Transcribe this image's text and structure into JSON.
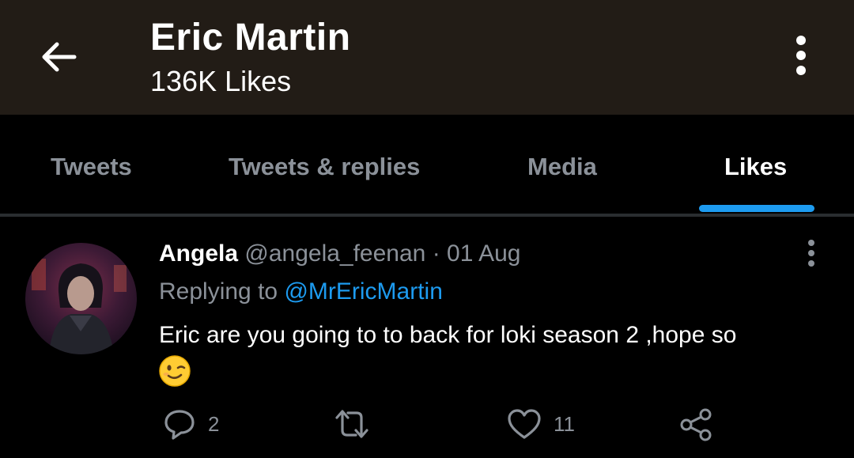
{
  "header": {
    "title": "Eric Martin",
    "subtitle": "136K Likes"
  },
  "tabs": [
    {
      "label": "Tweets",
      "active": false
    },
    {
      "label": "Tweets & replies",
      "active": false
    },
    {
      "label": "Media",
      "active": false
    },
    {
      "label": "Likes",
      "active": true
    }
  ],
  "tweet": {
    "name": "Angela",
    "handle": "@angela_feenan",
    "separator": "·",
    "date": "01 Aug",
    "replying_prefix": "Replying to",
    "replying_to": "@MrEricMartin",
    "text": "Eric are you going to to back for loki season 2 ,hope so",
    "emoji": "winking-face",
    "reply_count": "2",
    "retweet_count": "",
    "like_count": "11"
  },
  "colors": {
    "header_bg": "#221c16",
    "accent": "#1d9bf0",
    "muted_text": "#8b9199",
    "background": "#000000"
  },
  "icons": [
    "arrow-left-icon",
    "more-vertical-icon",
    "reply-icon",
    "retweet-icon",
    "heart-icon",
    "share-icon"
  ]
}
